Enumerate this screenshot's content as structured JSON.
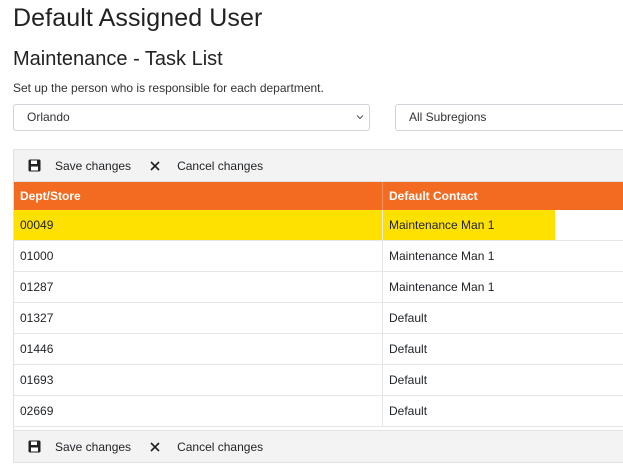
{
  "page": {
    "title": "Default Assigned User",
    "section_title": "Maintenance - Task List",
    "description": "Set up the person who is responsible for each department."
  },
  "filters": {
    "region": {
      "value": "Orlando"
    },
    "subregion": {
      "value": "All Subregions"
    }
  },
  "toolbar": {
    "save_label": "Save changes",
    "cancel_label": "Cancel changes"
  },
  "table": {
    "headers": {
      "dept": "Dept/Store",
      "contact": "Default Contact"
    },
    "rows": [
      {
        "dept": "00049",
        "contact": "Maintenance Man 1"
      },
      {
        "dept": "01000",
        "contact": "Maintenance Man 1"
      },
      {
        "dept": "01287",
        "contact": "Maintenance Man 1"
      },
      {
        "dept": "01327",
        "contact": "Default"
      },
      {
        "dept": "01446",
        "contact": "Default"
      },
      {
        "dept": "01693",
        "contact": "Default"
      },
      {
        "dept": "02669",
        "contact": "Default"
      }
    ]
  },
  "colors": {
    "header_orange": "#f26b21",
    "highlight_yellow": "#ffe100",
    "toolbar_gray": "#f3f3f3"
  },
  "icons": {
    "save": "floppy-disk-icon",
    "cancel": "close-icon",
    "dropdown": "chevron-down-icon"
  }
}
